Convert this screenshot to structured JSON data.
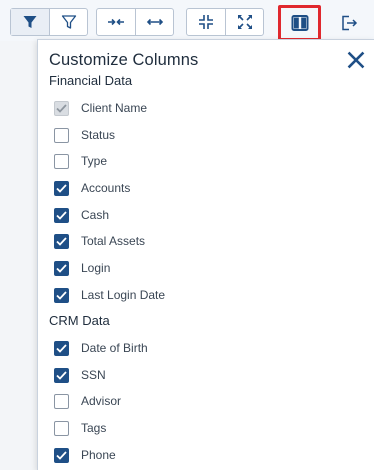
{
  "toolbar": {
    "buttons": [
      {
        "name": "filter-icon",
        "active": true
      },
      {
        "name": "filter-outline-icon",
        "active": false
      },
      {
        "name": "collapse-horizontal-icon",
        "active": false
      },
      {
        "name": "expand-horizontal-icon",
        "active": false
      },
      {
        "name": "collapse-icon",
        "active": false
      },
      {
        "name": "expand-icon",
        "active": false
      },
      {
        "name": "columns-icon",
        "active": false,
        "highlighted": true
      },
      {
        "name": "export-icon",
        "active": false
      }
    ]
  },
  "panel": {
    "title": "Customize Columns",
    "close_icon": "close-icon",
    "sections": [
      {
        "label": "Financial Data",
        "items": [
          {
            "label": "Client Name",
            "checked": true,
            "disabled": true
          },
          {
            "label": "Status",
            "checked": false,
            "disabled": false
          },
          {
            "label": "Type",
            "checked": false,
            "disabled": false
          },
          {
            "label": "Accounts",
            "checked": true,
            "disabled": false
          },
          {
            "label": "Cash",
            "checked": true,
            "disabled": false
          },
          {
            "label": "Total Assets",
            "checked": true,
            "disabled": false
          },
          {
            "label": "Login",
            "checked": true,
            "disabled": false
          },
          {
            "label": "Last Login Date",
            "checked": true,
            "disabled": false
          }
        ]
      },
      {
        "label": "CRM Data",
        "items": [
          {
            "label": "Date of Birth",
            "checked": true,
            "disabled": false
          },
          {
            "label": "SSN",
            "checked": true,
            "disabled": false
          },
          {
            "label": "Advisor",
            "checked": false,
            "disabled": false
          },
          {
            "label": "Tags",
            "checked": false,
            "disabled": false
          },
          {
            "label": "Phone",
            "checked": true,
            "disabled": false
          }
        ]
      }
    ]
  },
  "colors": {
    "accent": "#1f4f86",
    "highlight": "#e0282e",
    "band": "#e3ebf7"
  }
}
